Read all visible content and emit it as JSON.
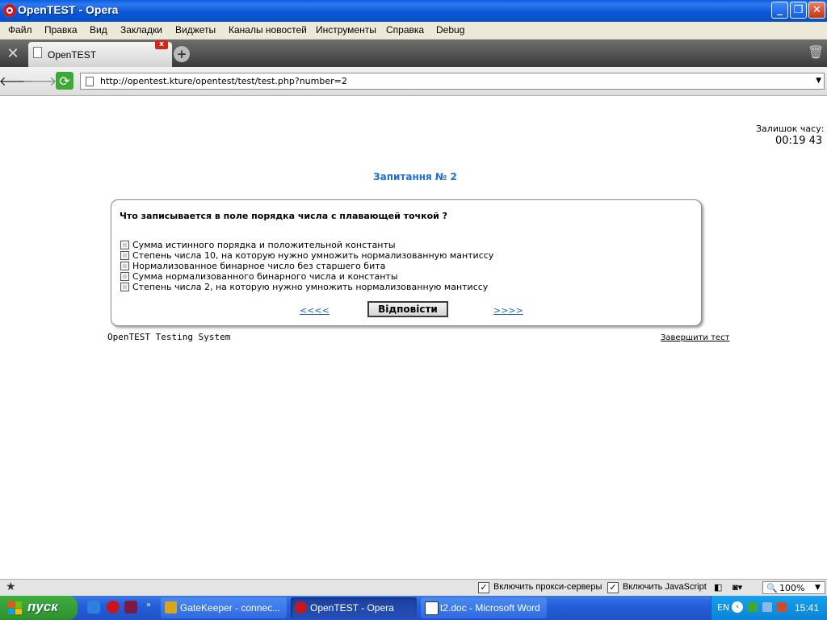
{
  "window": {
    "title": "OpenTEST - Opera",
    "min_icon": "_",
    "max_icon": "❐",
    "close_icon": "✕"
  },
  "menu": [
    "Файл",
    "Правка",
    "Вид",
    "Закладки",
    "Виджеты",
    "Каналы новостей",
    "Инструменты",
    "Справка",
    "Debug"
  ],
  "tabs": {
    "active_label": "OpenTEST",
    "close_glyph": "x",
    "new_tab_glyph": "+"
  },
  "address": {
    "url": "http://opentest.kture/opentest/test/test.php?number=2"
  },
  "page": {
    "time_label": "Залишок часу:",
    "time_value": "00:19 43",
    "question_title": "Запитання № 2",
    "question_text": "Что записывается в поле порядка числа с плавающей точкой ?",
    "options": [
      "Сумма истинного порядка и положительной константы",
      "Степень числа 10, на которую нужно умножить нормализованную мантиссу",
      "Нормализованное бинарное число без старшего бита",
      "Сумма нормализованного бинарного числа и константы",
      "Степень числа 2, на которую нужно умножить нормализованную мантиссу"
    ],
    "prev_link": "<<<<",
    "next_link": ">>>>",
    "answer_button": "Відповісти",
    "footer_system": "OpenTEST Testing System",
    "footer_finish": "Завершити тест"
  },
  "statusbar": {
    "proxy_label": "Включить прокси-серверы",
    "js_label": "Включить JavaScript",
    "zoom": "100%"
  },
  "taskbar": {
    "start_label": "пуск",
    "tasks": [
      "GateKeeper - connec...",
      "OpenTEST - Opera",
      "t2.doc - Microsoft Word"
    ],
    "lang": "EN",
    "clock": "15:41"
  },
  "colors": {
    "accent_blue": "#1f6fd0",
    "link_blue": "#2060c0",
    "opera_red": "#c8161d"
  }
}
